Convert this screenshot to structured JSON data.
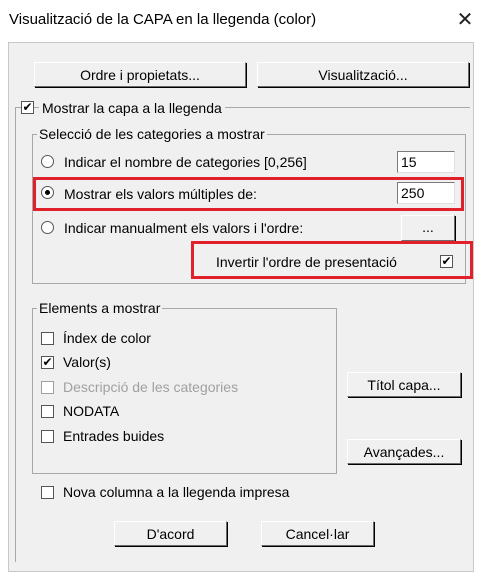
{
  "window": {
    "title": "Visualització de la CAPA en la llegenda (color)",
    "close": "✕"
  },
  "top_buttons": {
    "order_props": "Ordre i propietats...",
    "visualization": "Visualització..."
  },
  "show_layer": {
    "label": "Mostrar la capa a la llegenda",
    "checked": true
  },
  "categories_group": {
    "title": "Selecció de les categories a mostrar",
    "options": [
      {
        "label": "Indicar el nombre de categories [0,256]",
        "value": "15",
        "selected": false
      },
      {
        "label": "Mostrar els valors múltiples de:",
        "value": "250",
        "selected": true
      },
      {
        "label": "Indicar manualment els valors i l'ordre:",
        "button": "...",
        "selected": false
      }
    ],
    "invert": {
      "label": "Invertir l'ordre de presentació",
      "checked": true
    }
  },
  "elements_group": {
    "title": "Elements a mostrar",
    "items": [
      {
        "label": "Índex de color",
        "checked": false,
        "enabled": true
      },
      {
        "label": "Valor(s)",
        "checked": true,
        "enabled": true
      },
      {
        "label": "Descripció de les categories",
        "checked": false,
        "enabled": false
      },
      {
        "label": "NODATA",
        "checked": false,
        "enabled": true
      },
      {
        "label": "Entrades buides",
        "checked": false,
        "enabled": true
      }
    ]
  },
  "side_buttons": {
    "layer_title": "Títol capa...",
    "advanced": "Avançades..."
  },
  "new_column": {
    "label": "Nova columna a la llegenda impresa",
    "checked": false
  },
  "footer": {
    "ok": "D'acord",
    "cancel": "Cancel·lar"
  },
  "colors": {
    "highlight": "#e0202a",
    "dialog_bg": "#f0f0f0"
  }
}
